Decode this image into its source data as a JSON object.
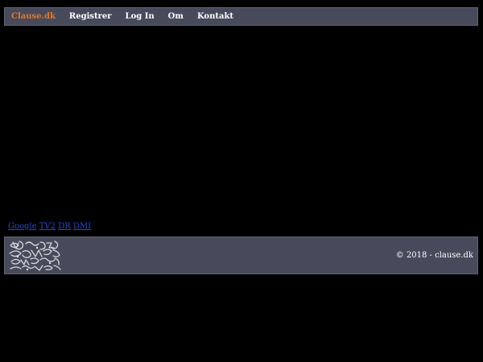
{
  "nav": {
    "brand": "Clause.dk",
    "items": [
      {
        "label": "Registrer"
      },
      {
        "label": "Log In"
      },
      {
        "label": "Om"
      },
      {
        "label": "Kontakt"
      }
    ]
  },
  "quick_links": [
    {
      "label": "Google"
    },
    {
      "label": "TV2"
    },
    {
      "label": "DR"
    },
    {
      "label": "DMI"
    }
  ],
  "footer": {
    "copyright": "© 2018 - clause.dk",
    "logo_icon": "scribble-logo-icon"
  },
  "colors": {
    "bar_background": "#474a5b",
    "brand": "#e2762c",
    "link": "#2b4bc9",
    "page_background": "#000000"
  }
}
